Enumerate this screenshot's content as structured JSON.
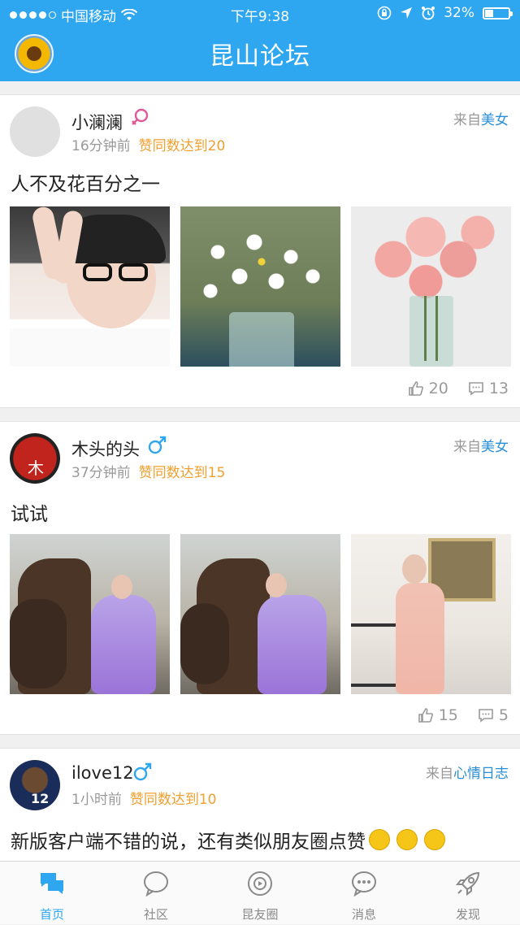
{
  "status": {
    "carrier": "中国移动",
    "time": "下午9:38",
    "battery": "32%",
    "battery_level": 0.32
  },
  "header": {
    "title": "昆山论坛",
    "avatar_icon": "sunflower-avatar"
  },
  "posts": [
    {
      "username": "小澜澜",
      "gender": "female",
      "time": "16分钟前",
      "badge": "赞同数达到20",
      "source_prefix": "来自",
      "source_category": "美女",
      "text": "人不及花百分之一",
      "likes": "20",
      "comments": "13"
    },
    {
      "username": "木头的头",
      "gender": "male",
      "time": "37分钟前",
      "badge": "赞同数达到15",
      "source_prefix": "来自",
      "source_category": "美女",
      "text": "试试",
      "likes": "15",
      "comments": "5"
    },
    {
      "username": "ilove12",
      "gender": "male",
      "time": "1小时前",
      "badge": "赞同数达到10",
      "source_prefix": "来自",
      "source_category": "心情日志",
      "text": "新版客户端不错的说，还有类似朋友圈点赞"
    }
  ],
  "tabs": [
    {
      "label": "首页",
      "icon": "home-chat-icon",
      "active": true
    },
    {
      "label": "社区",
      "icon": "community-bubble-icon",
      "active": false
    },
    {
      "label": "昆友圈",
      "icon": "friends-circle-icon",
      "active": false
    },
    {
      "label": "消息",
      "icon": "message-dots-icon",
      "active": false
    },
    {
      "label": "发现",
      "icon": "rocket-icon",
      "active": false
    }
  ],
  "colors": {
    "brand": "#2ea7f0",
    "badge": "#f0a030",
    "category": "#2a8fd8",
    "female": "#e0589a",
    "male": "#2ea7f0"
  }
}
